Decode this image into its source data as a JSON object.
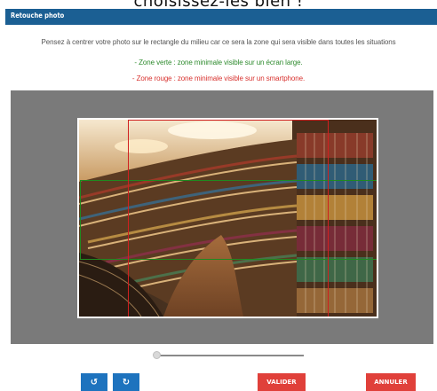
{
  "background_heading": "choisissez-les bien !",
  "dialog": {
    "title": "Retouche photo"
  },
  "instructions": {
    "line1": "Pensez à centrer votre photo sur le rectangle du milieu car ce sera la zone qui sera visible dans toutes les situations",
    "line2": "- Zone verte : zone minimale visible sur un écran large.",
    "line3": "- Zone rouge : zone minimale visible sur un smartphone."
  },
  "colors": {
    "title_bar": "#1b5f93",
    "green_zone": "#1f8a1f",
    "red_zone": "#d02020",
    "editor_bg": "#7a7a7a",
    "primary_button": "#1e73be",
    "danger_button": "#e0403a"
  },
  "zoom_slider": {
    "value": 0
  },
  "toolbar": {
    "rotate_left_icon": "rotate-left-icon",
    "rotate_right_icon": "rotate-right-icon",
    "rotate_left_glyph": "↺",
    "rotate_right_glyph": "↻",
    "validate_label": "VALIDER",
    "cancel_label": "ANNULER"
  },
  "photo": {
    "subject": "library-bookshelves"
  }
}
